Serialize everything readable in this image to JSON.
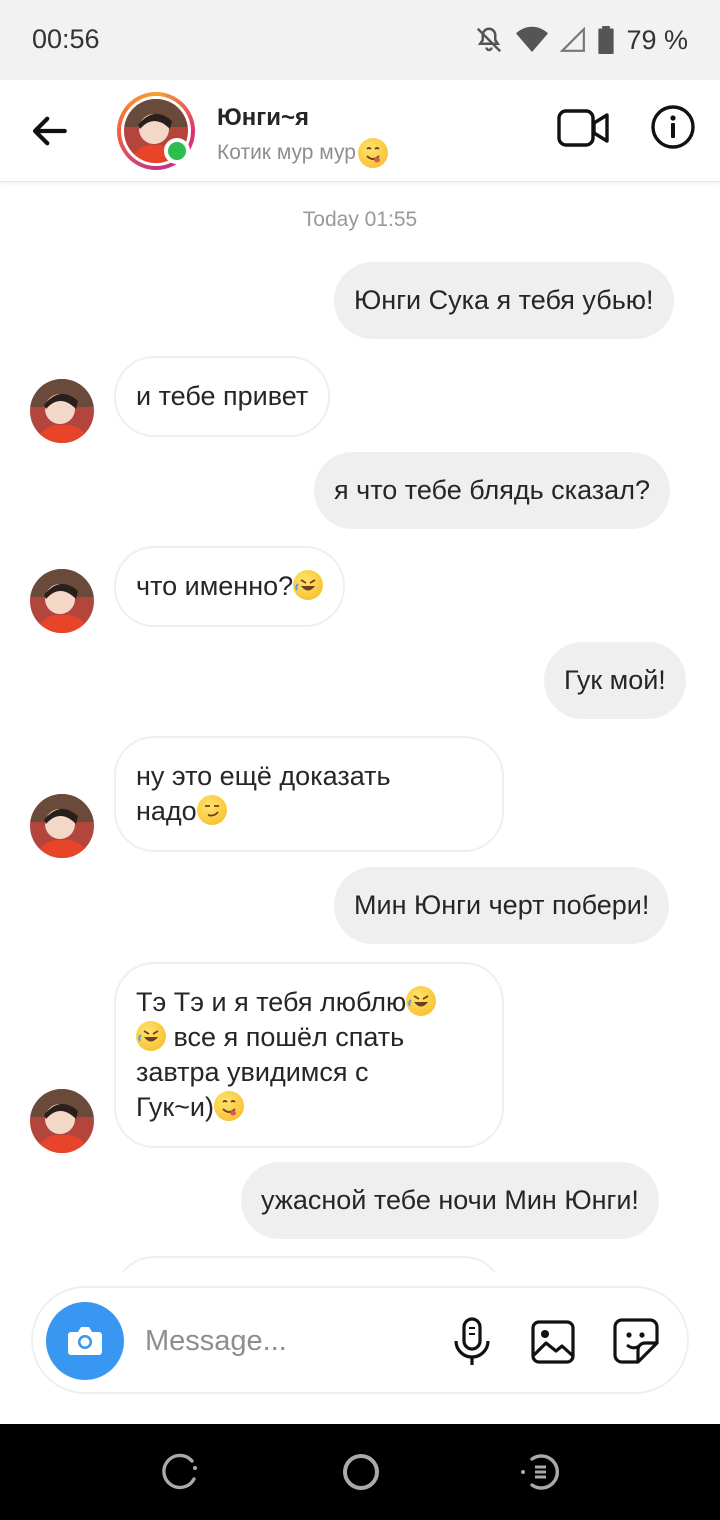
{
  "status_bar": {
    "time": "00:56",
    "battery": "79 %",
    "icons": [
      "mute-bell-icon",
      "wifi-icon",
      "cell-signal-icon",
      "battery-icon"
    ]
  },
  "header": {
    "contact_name": "Юнги~я",
    "contact_status": "Котик мур мур",
    "online": true,
    "icons": [
      "back-arrow-icon",
      "video-call-icon",
      "info-icon"
    ]
  },
  "chat": {
    "timestamp": "Today 01:55",
    "messages": [
      {
        "from": "me",
        "text": "Юнги Сука я тебя убью!"
      },
      {
        "from": "them",
        "text": "и тебе привет"
      },
      {
        "from": "me",
        "text": "я что тебе блядь сказал?"
      },
      {
        "from": "them",
        "text": "что именно?",
        "emoji": "rofl"
      },
      {
        "from": "me",
        "text": "Гук мой!"
      },
      {
        "from": "them",
        "lines": [
          "ну это ещё доказать",
          "надо"
        ],
        "emoji": "smirk"
      },
      {
        "from": "me",
        "text": "Мин Юнги черт побери!"
      },
      {
        "from": "them",
        "lines": [
          "Тэ Тэ и я тебя люблю",
          "все я пошёл спать",
          "завтра увидимся с",
          "Гук~и)"
        ],
        "emojis": [
          "rofl",
          "rofl",
          "yum"
        ]
      },
      {
        "from": "me",
        "text": "ужасной тебе ночи Мин Юнги!"
      }
    ]
  },
  "composer": {
    "placeholder": "Message...",
    "icons": [
      "camera-icon",
      "microphone-icon",
      "gallery-icon",
      "sticker-icon"
    ]
  },
  "colors": {
    "accent": "#3897f0",
    "outgoing_bubble": "#efefef",
    "online_dot": "#2dbd4e"
  }
}
